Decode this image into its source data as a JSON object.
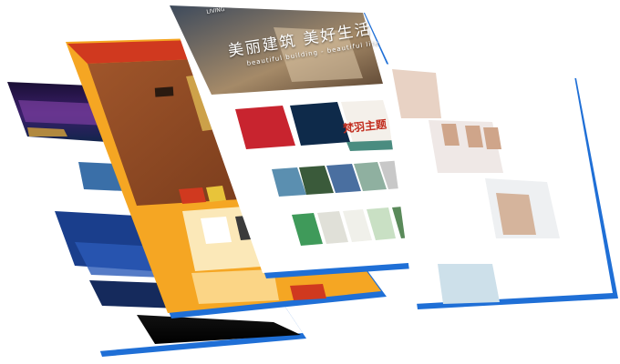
{
  "hero": {
    "brand": "LIVING",
    "title": "美丽建筑 美好生活",
    "subtitle": "beautiful building - beautiful life"
  },
  "book_panel": {
    "red_calligraphy": "梵羽主题"
  },
  "colors": {
    "blue_edge": "#1f6fd6",
    "orange_panel": "#f5a623",
    "red_header": "#d0391f",
    "teal_bar": "#4a8c80"
  }
}
